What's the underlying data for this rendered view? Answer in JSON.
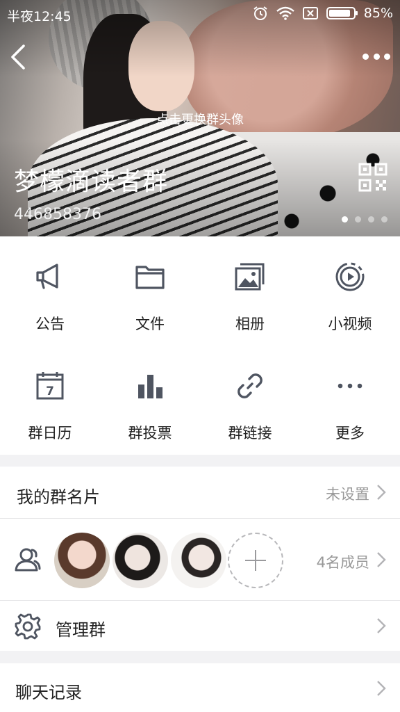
{
  "status_bar": {
    "time": "半夜12:45",
    "battery": "85%",
    "icons": [
      "alarm-icon",
      "wifi-icon",
      "sim-off-icon",
      "battery-icon"
    ]
  },
  "header": {
    "change_avatar_hint": "点击更换群头像",
    "group_name": "梦檬滴读者群",
    "group_id": "446858376",
    "pager": {
      "total": 4,
      "active": 1
    }
  },
  "features": [
    {
      "label": "公告",
      "icon": "megaphone-icon"
    },
    {
      "label": "文件",
      "icon": "folder-icon"
    },
    {
      "label": "相册",
      "icon": "photo-album-icon"
    },
    {
      "label": "小视频",
      "icon": "video-play-icon"
    },
    {
      "label": "群日历",
      "icon": "calendar-icon"
    },
    {
      "label": "群投票",
      "icon": "bar-chart-icon"
    },
    {
      "label": "群链接",
      "icon": "link-icon"
    },
    {
      "label": "更多",
      "icon": "more-dots-icon"
    }
  ],
  "calendar_day": "7",
  "my_card": {
    "title": "我的群名片",
    "value": "未设置"
  },
  "members": {
    "count_label": "4名成员",
    "icon": "members-icon"
  },
  "manage": {
    "title": "管理群",
    "icon": "gear-icon"
  },
  "chat_history": {
    "title": "聊天记录"
  },
  "colors": {
    "icon_gray": "#4f5561",
    "divider": "#e4e4e6",
    "background": "#f2f2f4"
  }
}
